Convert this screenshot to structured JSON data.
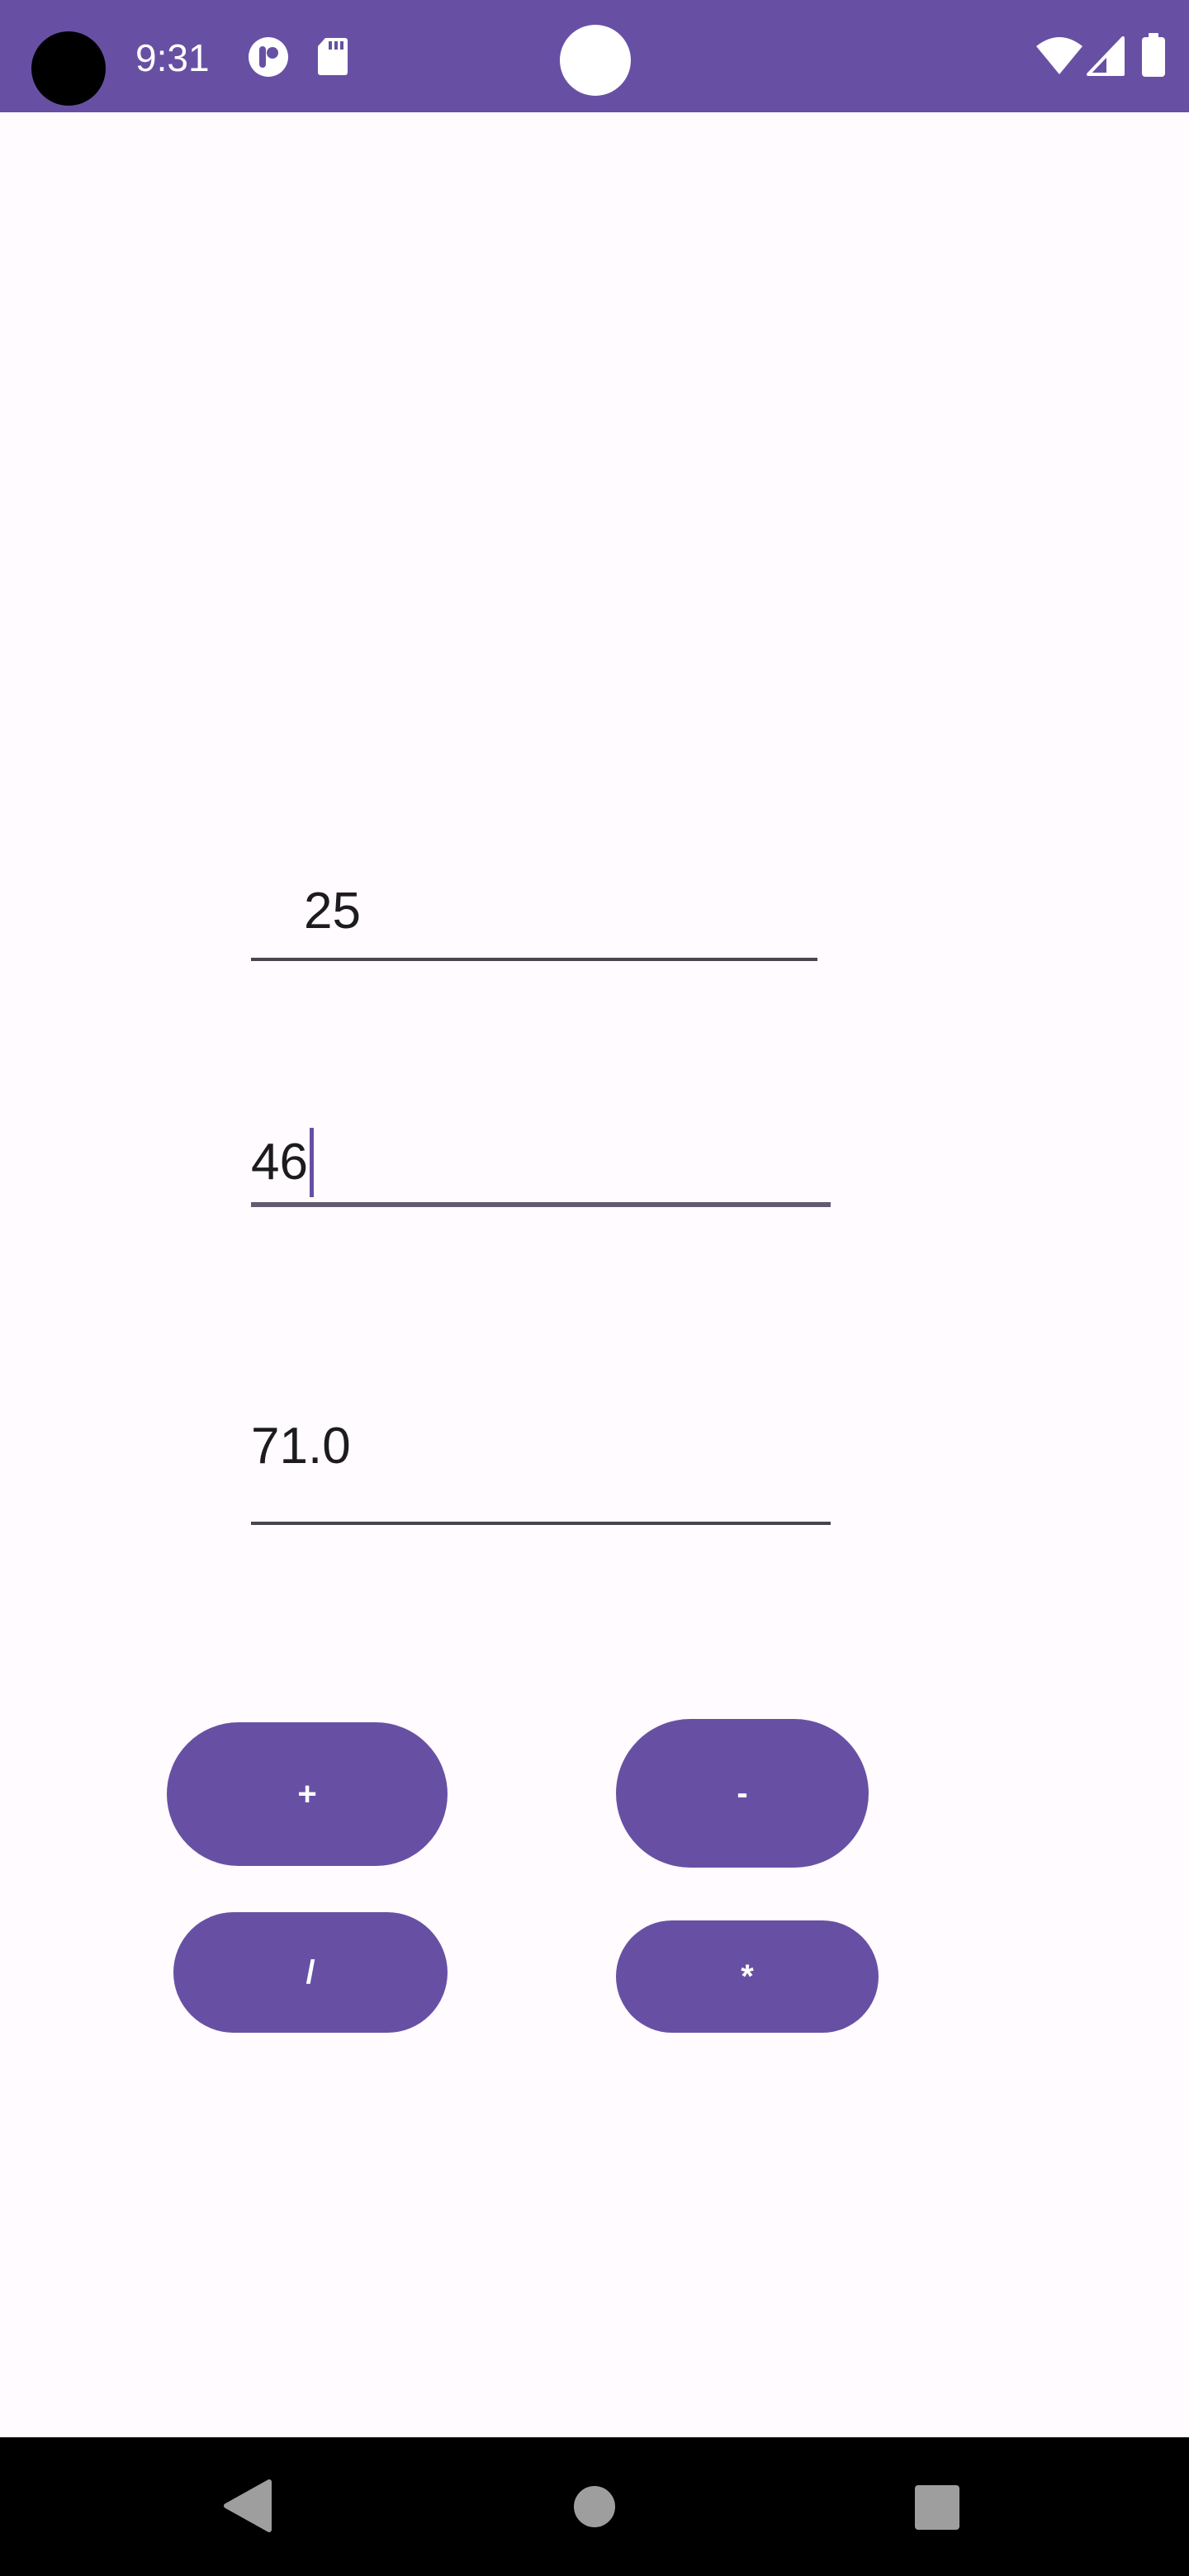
{
  "status_bar": {
    "time": "9:31",
    "color": "#6750A4",
    "icons": [
      "pocket-casts-icon",
      "sd-card-icon",
      "wifi-icon",
      "cellular-signal-icon",
      "battery-icon"
    ]
  },
  "inputs": {
    "first_number": "25",
    "second_number": "46",
    "result": "71.0"
  },
  "buttons": {
    "add": "+",
    "subtract": "-",
    "divide": "/",
    "multiply": "*"
  },
  "nav_bar": {
    "icons": [
      "back-icon",
      "home-icon",
      "recents-icon"
    ]
  },
  "colors": {
    "primary": "#6750A4",
    "background": "#FFFBFE",
    "text": "#1C1B1F"
  }
}
